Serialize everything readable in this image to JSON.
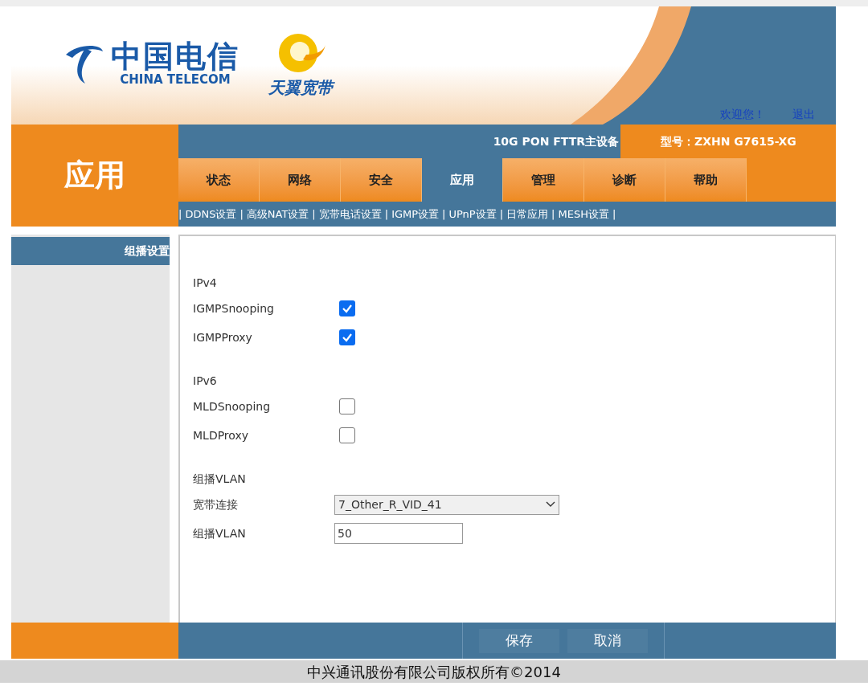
{
  "header": {
    "logo_cn": "中国电信",
    "logo_en": "CHINA TELECOM",
    "brand": "天翼宽带",
    "welcome": "欢迎您！",
    "logout": "退出"
  },
  "page_title": "应用",
  "device": {
    "name": "10G PON FTTR主设备",
    "model": "型号：ZXHN G7615-XG"
  },
  "tabs": [
    {
      "label": "状态",
      "selected": false
    },
    {
      "label": "网络",
      "selected": false
    },
    {
      "label": "安全",
      "selected": false
    },
    {
      "label": "应用",
      "selected": true
    },
    {
      "label": "管理",
      "selected": false
    },
    {
      "label": "诊断",
      "selected": false
    },
    {
      "label": "帮助",
      "selected": false
    }
  ],
  "subnav": {
    "separator": "|",
    "items": [
      "DDNS设置",
      "高级NAT设置",
      "宽带电话设置",
      "IGMP设置",
      "UPnP设置",
      "日常应用",
      "MESH设置"
    ]
  },
  "sidebar": {
    "items": [
      {
        "label": "组播设置",
        "selected": true
      }
    ]
  },
  "form": [
    {
      "kind": "heading",
      "label": "IPv4"
    },
    {
      "kind": "checkbox",
      "label": "IGMPSnooping",
      "checked": true
    },
    {
      "kind": "checkbox",
      "label": "IGMPProxy",
      "checked": true
    },
    {
      "kind": "heading",
      "label": "IPv6"
    },
    {
      "kind": "checkbox",
      "label": "MLDSnooping",
      "checked": false
    },
    {
      "kind": "checkbox",
      "label": "MLDProxy",
      "checked": false
    },
    {
      "kind": "heading",
      "label": "组播VLAN"
    },
    {
      "kind": "select",
      "label": "宽带连接",
      "value": "7_Other_R_VID_41"
    },
    {
      "kind": "input",
      "label": "组播VLAN",
      "value": "50"
    }
  ],
  "buttons": [
    "保存",
    "取消"
  ],
  "footer": "中兴通讯股份有限公司版权所有©2014"
}
